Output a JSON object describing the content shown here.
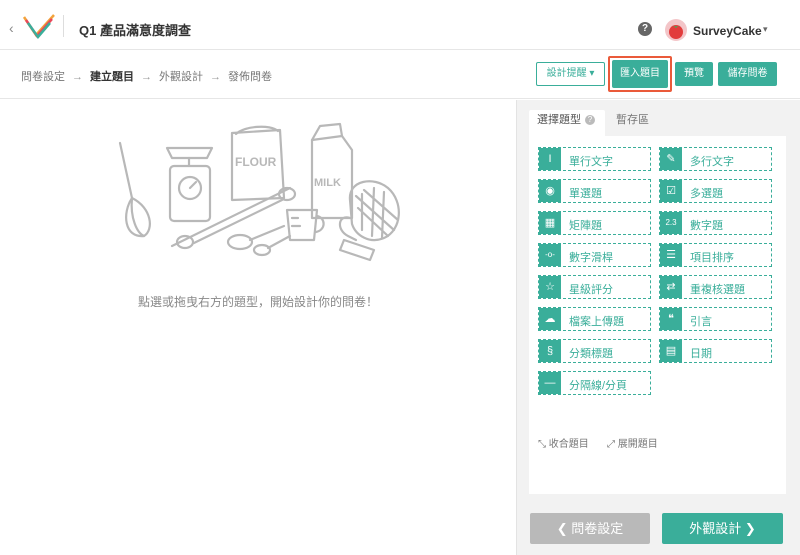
{
  "header": {
    "title": "Q1 產品滿意度調查",
    "user_name": "SurveyCake",
    "help_symbol": "?",
    "back_symbol": "‹",
    "caret_symbol": "▾"
  },
  "breadcrumb": {
    "steps": [
      "問卷設定",
      "建立題目",
      "外觀設計",
      "發佈問卷"
    ],
    "active_index": 1,
    "separator": "→"
  },
  "toolbar": {
    "design_tips_label": "設計提醒 ▾",
    "import_label": "匯入題目",
    "preview_label": "預覽",
    "save_label": "儲存問卷"
  },
  "canvas": {
    "empty_hint": "點選或拖曳右方的題型，開始設計你的問卷！",
    "illustration_words": [
      "FLOUR",
      "MILK"
    ]
  },
  "panel": {
    "tabs": [
      {
        "label": "選擇題型",
        "icon": "question-icon",
        "active": true
      },
      {
        "label": "暫存區",
        "active": false
      }
    ],
    "question_types": [
      {
        "label": "單行文字",
        "icon": "single-line-text-icon",
        "glyph": "I"
      },
      {
        "label": "多行文字",
        "icon": "multi-line-text-icon",
        "glyph": "✎"
      },
      {
        "label": "單選題",
        "icon": "radio-icon",
        "glyph": "◉"
      },
      {
        "label": "多選題",
        "icon": "checkbox-icon",
        "glyph": "☑"
      },
      {
        "label": "矩陣題",
        "icon": "matrix-icon",
        "glyph": "▦"
      },
      {
        "label": "數字題",
        "icon": "number-icon",
        "glyph": "2.3"
      },
      {
        "label": "數字滑桿",
        "icon": "slider-icon",
        "glyph": "-o-"
      },
      {
        "label": "項目排序",
        "icon": "sort-list-icon",
        "glyph": "☰"
      },
      {
        "label": "星級評分",
        "icon": "star-icon",
        "glyph": "☆"
      },
      {
        "label": "重複核選題",
        "icon": "repeat-check-icon",
        "glyph": "⇄"
      },
      {
        "label": "檔案上傳題",
        "icon": "cloud-upload-icon",
        "glyph": "☁"
      },
      {
        "label": "引言",
        "icon": "quote-icon",
        "glyph": "❝"
      },
      {
        "label": "分類標題",
        "icon": "section-icon",
        "glyph": "§"
      },
      {
        "label": "日期",
        "icon": "calendar-icon",
        "glyph": "▤"
      },
      {
        "label": "分隔線/分頁",
        "icon": "divider-icon",
        "glyph": "—"
      }
    ],
    "collapse_label": "收合題目",
    "expand_label": "展開題目"
  },
  "footer_nav": {
    "prev_label": "❮ 問卷設定",
    "next_label": "外觀設計 ❯"
  },
  "colors": {
    "accent": "#3aae9a",
    "highlight": "#ea5a3a",
    "disabled": "#b9b9b9"
  }
}
